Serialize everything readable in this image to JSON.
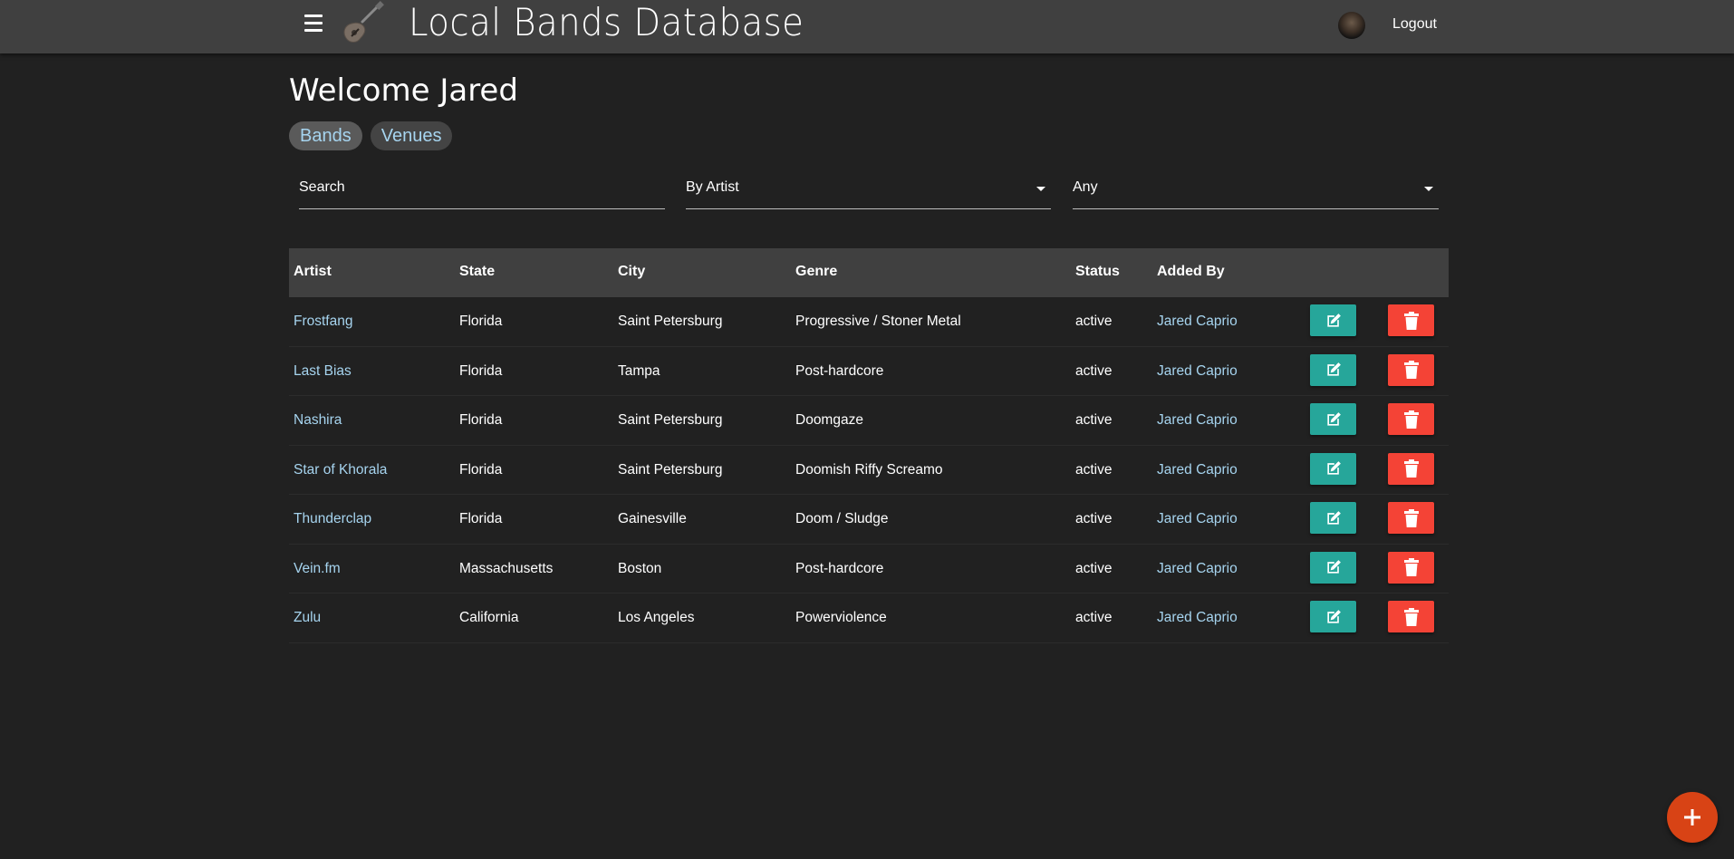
{
  "header": {
    "title": "Local Bands Database",
    "logout_label": "Logout"
  },
  "welcome_text": "Welcome Jared",
  "tabs": [
    {
      "label": "Bands",
      "active": true
    },
    {
      "label": "Venues",
      "active": false
    }
  ],
  "filters": {
    "search_placeholder": "Search",
    "search_by": "By Artist",
    "status": "Any"
  },
  "table": {
    "columns": [
      "Artist",
      "State",
      "City",
      "Genre",
      "Status",
      "Added By"
    ],
    "rows": [
      {
        "artist": "Frostfang",
        "state": "Florida",
        "city": "Saint Petersburg",
        "genre": "Progressive / Stoner Metal",
        "status": "active",
        "added_by": "Jared Caprio"
      },
      {
        "artist": "Last Bias",
        "state": "Florida",
        "city": "Tampa",
        "genre": "Post-hardcore",
        "status": "active",
        "added_by": "Jared Caprio"
      },
      {
        "artist": "Nashira",
        "state": "Florida",
        "city": "Saint Petersburg",
        "genre": "Doomgaze",
        "status": "active",
        "added_by": "Jared Caprio"
      },
      {
        "artist": "Star of Khorala",
        "state": "Florida",
        "city": "Saint Petersburg",
        "genre": "Doomish Riffy Screamo",
        "status": "active",
        "added_by": "Jared Caprio"
      },
      {
        "artist": "Thunderclap",
        "state": "Florida",
        "city": "Gainesville",
        "genre": "Doom / Sludge",
        "status": "active",
        "added_by": "Jared Caprio"
      },
      {
        "artist": "Vein.fm",
        "state": "Massachusetts",
        "city": "Boston",
        "genre": "Post-hardcore",
        "status": "active",
        "added_by": "Jared Caprio"
      },
      {
        "artist": "Zulu",
        "state": "California",
        "city": "Los Angeles",
        "genre": "Powerviolence",
        "status": "active",
        "added_by": "Jared Caprio"
      }
    ]
  },
  "icons": {
    "menu": "hamburger-menu-icon",
    "logo": "guitar-icon",
    "edit": "edit-icon",
    "delete": "trash-icon",
    "add": "plus-icon"
  },
  "colors": {
    "background": "#212121",
    "topbar": "#404040",
    "link": "#a6d4ef",
    "edit_button": "#26a69a",
    "delete_button": "#f44336",
    "fab": "#d84315"
  }
}
